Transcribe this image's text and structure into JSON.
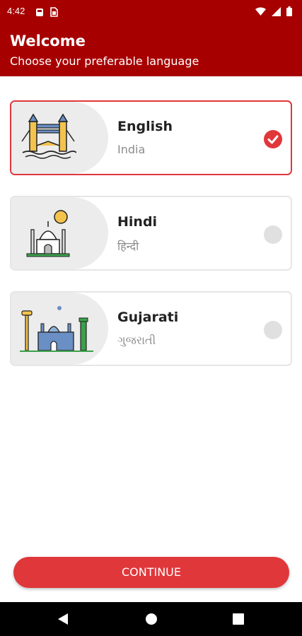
{
  "status_bar": {
    "time": "4:42",
    "icons": [
      "notification-icon",
      "sim-icon",
      "wifi-icon",
      "signal-icon",
      "battery-icon"
    ]
  },
  "header": {
    "title": "Welcome",
    "subtitle": "Choose your preferable language"
  },
  "languages": [
    {
      "name": "English",
      "native": "India",
      "selected": true,
      "illustration": "tower-bridge-icon"
    },
    {
      "name": "Hindi",
      "native": "हिन्दी",
      "selected": false,
      "illustration": "taj-mahal-icon"
    },
    {
      "name": "Gujarati",
      "native": "ગુજરાતી",
      "selected": false,
      "illustration": "gujarat-landmarks-icon"
    }
  ],
  "continue_label": "CONTINUE",
  "nav_bar": [
    "back-icon",
    "home-icon",
    "recents-icon"
  ],
  "colors": {
    "brand": "#a70000",
    "accent": "#e0373b"
  }
}
